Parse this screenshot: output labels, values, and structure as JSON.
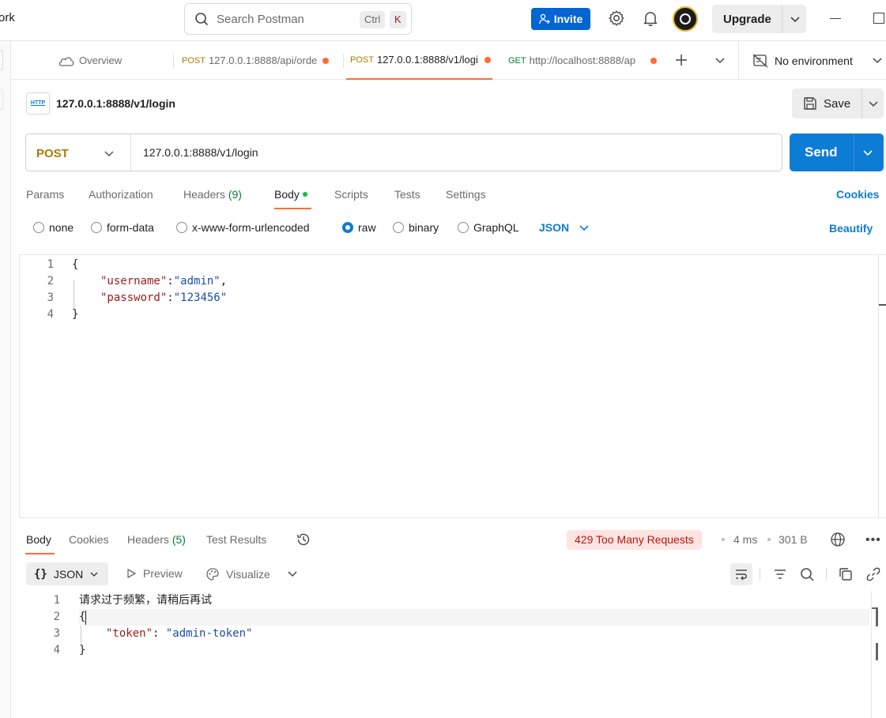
{
  "topbar": {
    "workspace_fragment": "ork",
    "search_placeholder": "Search Postman",
    "shortcut_ctrl": "Ctrl",
    "shortcut_key": "K",
    "invite_label": "Invite",
    "upgrade_label": "Upgrade",
    "icons": [
      "search-icon",
      "person-add-icon",
      "gear-icon",
      "bell-icon",
      "chevron-down-icon"
    ]
  },
  "tabs": {
    "overview_label": "Overview",
    "items": [
      {
        "method": "POST",
        "url": "127.0.0.1:8888/api/orde",
        "unsaved": true,
        "active": false
      },
      {
        "method": "POST",
        "url": "127.0.0.1:8888/v1/logi",
        "unsaved": true,
        "active": true
      },
      {
        "method": "GET",
        "url": "http://localhost:8888/ap",
        "unsaved": true,
        "active": false
      }
    ],
    "environment_label": "No environment"
  },
  "request": {
    "name": "127.0.0.1:8888/v1/login",
    "icon_text": "HTTP",
    "save_label": "Save",
    "method": "POST",
    "url": "127.0.0.1:8888/v1/login",
    "send_label": "Send",
    "subtabs": {
      "params": "Params",
      "authorization": "Authorization",
      "headers": "Headers",
      "headers_count": "(9)",
      "body": "Body",
      "scripts": "Scripts",
      "tests": "Tests",
      "settings": "Settings",
      "cookies": "Cookies"
    },
    "body_modes": {
      "none": "none",
      "form_data": "form-data",
      "urlencoded": "x-www-form-urlencoded",
      "raw": "raw",
      "binary": "binary",
      "graphql": "GraphQL",
      "selected": "raw",
      "language": "JSON",
      "beautify": "Beautify"
    },
    "body_lines": {
      "l1": "{",
      "l2_key": "\"username\"",
      "l2_colon": ":",
      "l2_val": "\"admin\"",
      "l2_comma": ",",
      "l3_key": "\"password\"",
      "l3_colon": ":",
      "l3_val": "\"123456\"",
      "l4": "}"
    },
    "line_numbers": [
      "1",
      "2",
      "3",
      "4"
    ]
  },
  "response": {
    "tabs": {
      "body": "Body",
      "cookies": "Cookies",
      "headers": "Headers",
      "headers_count": "(5)",
      "test_results": "Test Results"
    },
    "status": "429 Too Many Requests",
    "time": "4 ms",
    "size": "301 B",
    "more": "•••",
    "format_label": "JSON",
    "format_braces": "{}",
    "preview_label": "Preview",
    "visualize_label": "Visualize",
    "body_lines": {
      "l1": "请求过于频繁，请稍后再试",
      "l2": "{",
      "l3_key": "\"token\"",
      "l3_colon": ": ",
      "l3_val": "\"admin-token\"",
      "l4": "}"
    },
    "line_numbers": [
      "1",
      "2",
      "3",
      "4"
    ]
  },
  "colors": {
    "accent_orange": "#ff6c37",
    "send_blue": "#0c7cd5",
    "invite_blue": "#0265d2",
    "post_method": "#ad7a03",
    "get_method": "#007f31",
    "status_error_bg": "#ffe4e1",
    "status_error_text": "#b11a0f"
  }
}
